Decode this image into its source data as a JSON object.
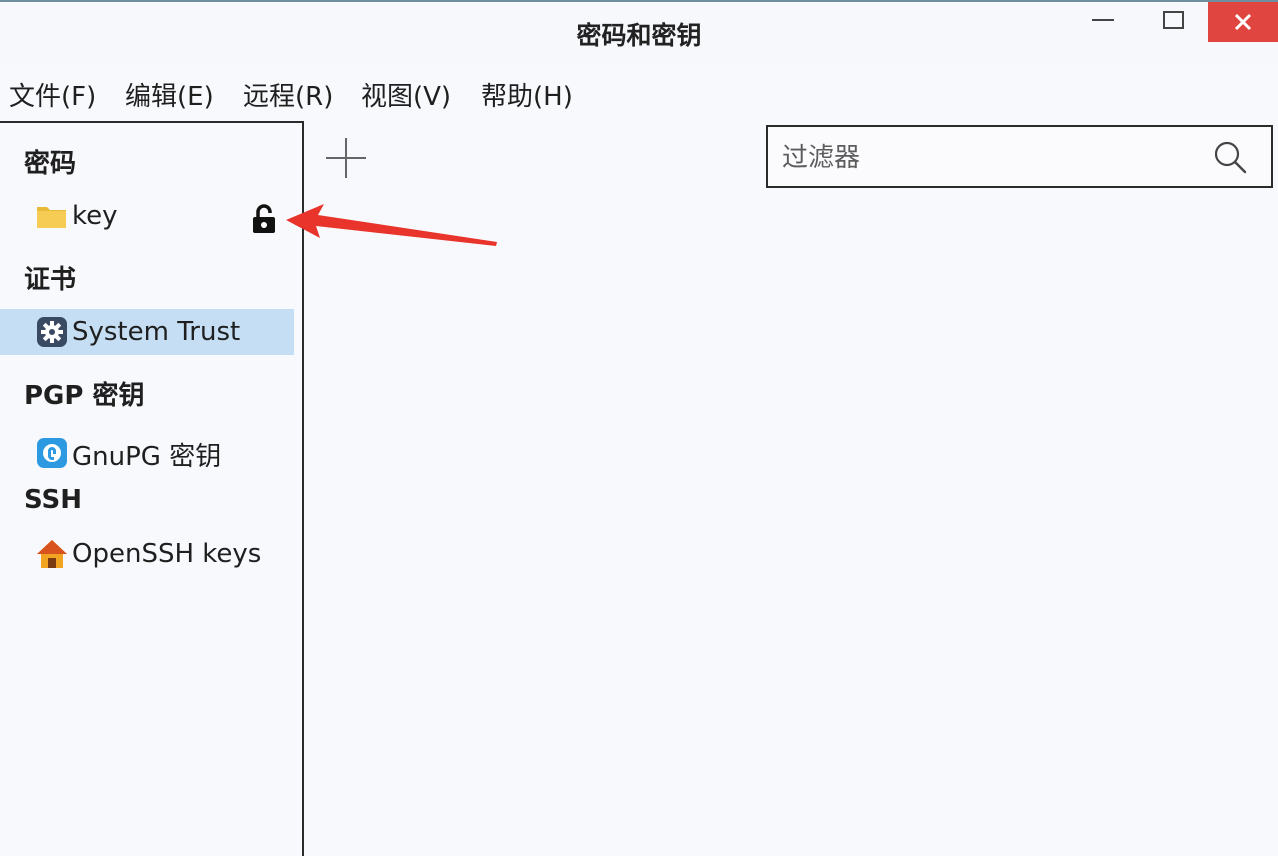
{
  "window": {
    "title": "密码和密钥"
  },
  "menu": [
    {
      "label": "文件(F)"
    },
    {
      "label": "编辑(E)"
    },
    {
      "label": "远程(R)"
    },
    {
      "label": "视图(V)"
    },
    {
      "label": "帮助(H)"
    }
  ],
  "sidebar": {
    "sections": [
      {
        "title": "密码",
        "items": [
          {
            "label": "key",
            "icon": "folder-icon",
            "locked": false
          }
        ]
      },
      {
        "title": "证书",
        "items": [
          {
            "label": "System Trust",
            "icon": "gear-icon",
            "selected": true
          }
        ]
      },
      {
        "title": "PGP 密钥",
        "items": [
          {
            "label": "GnuPG 密钥",
            "icon": "gnupg-icon"
          }
        ]
      },
      {
        "title": "SSH",
        "items": [
          {
            "label": "OpenSSH keys",
            "icon": "home-icon"
          }
        ]
      }
    ]
  },
  "toolbar": {
    "add_icon": "plus-icon"
  },
  "search": {
    "placeholder": "过滤器",
    "icon": "search-icon"
  },
  "annotation": {
    "color": "#e8342a"
  }
}
